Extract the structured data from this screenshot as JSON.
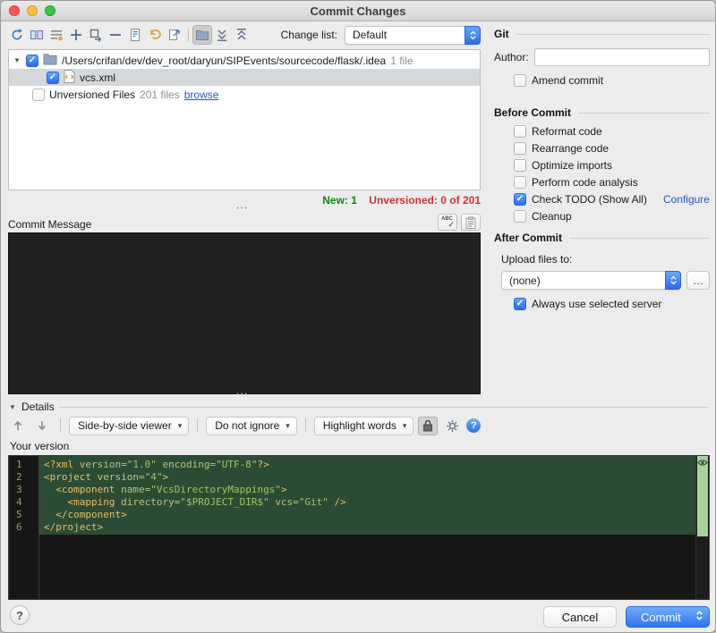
{
  "window": {
    "title": "Commit Changes"
  },
  "icons": {
    "disclosure_down": "▼",
    "dropdown_arrow": "▾",
    "splitter_dots": "•••",
    "check": "✓",
    "abc": "ABC",
    "help": "?"
  },
  "toolbar": {
    "change_list_label": "Change list:",
    "change_list_value": "Default"
  },
  "tree": {
    "rows": [
      {
        "path": "/Users/crifan/dev/dev_root/daryun/SIPEvents/sourcecode/flask/.idea",
        "meta": "1 file",
        "checked": true
      },
      {
        "file": "vcs.xml",
        "checked": true,
        "selected": true
      },
      {
        "label": "Unversioned Files",
        "meta": "201 files",
        "link": "browse",
        "checked": false
      }
    ]
  },
  "status": {
    "new": "New: 1",
    "unversioned": "Unversioned: 0 of 201"
  },
  "commit_message": {
    "label": "Commit Message",
    "value": ""
  },
  "git": {
    "title": "Git",
    "author_label": "Author:",
    "author_value": "",
    "amend_label": "Amend commit"
  },
  "before_commit": {
    "title": "Before Commit",
    "items": [
      {
        "label": "Reformat code",
        "checked": false
      },
      {
        "label": "Rearrange code",
        "checked": false
      },
      {
        "label": "Optimize imports",
        "checked": false
      },
      {
        "label": "Perform code analysis",
        "checked": false
      },
      {
        "label": "Check TODO (Show All)",
        "checked": true,
        "link": "Configure"
      },
      {
        "label": "Cleanup",
        "checked": false
      }
    ]
  },
  "after_commit": {
    "title": "After Commit",
    "upload_label": "Upload files to:",
    "upload_value": "(none)",
    "more": "…",
    "always_label": "Always use selected server",
    "always_checked": true
  },
  "details": {
    "title": "Details",
    "viewer": "Side-by-side viewer",
    "ignore": "Do not ignore",
    "highlight": "Highlight words",
    "version_label": "Your version"
  },
  "diff": {
    "lines": [
      {
        "num": "1",
        "parts": [
          [
            "<?xml ",
            "tag"
          ],
          [
            "version=",
            "attr"
          ],
          [
            "\"1.0\"",
            "val"
          ],
          [
            " ",
            "p"
          ],
          [
            "encoding=",
            "attr"
          ],
          [
            "\"UTF-8\"",
            "val"
          ],
          [
            "?>",
            "tag"
          ]
        ]
      },
      {
        "num": "2",
        "parts": [
          [
            "<project ",
            "tag"
          ],
          [
            "version=",
            "attr"
          ],
          [
            "\"4\"",
            "val"
          ],
          [
            ">",
            "tag"
          ]
        ]
      },
      {
        "num": "3",
        "parts": [
          [
            "  ",
            "p"
          ],
          [
            "<component ",
            "tag"
          ],
          [
            "name=",
            "attr"
          ],
          [
            "\"VcsDirectoryMappings\"",
            "val"
          ],
          [
            ">",
            "tag"
          ]
        ]
      },
      {
        "num": "4",
        "parts": [
          [
            "    ",
            "p"
          ],
          [
            "<mapping ",
            "tag"
          ],
          [
            "directory=",
            "attr"
          ],
          [
            "\"$PROJECT_DIR$\"",
            "val"
          ],
          [
            " ",
            "p"
          ],
          [
            "vcs=",
            "attr"
          ],
          [
            "\"Git\"",
            "val"
          ],
          [
            " />",
            "tag"
          ]
        ]
      },
      {
        "num": "5",
        "parts": [
          [
            "  ",
            "p"
          ],
          [
            "</component>",
            "tag"
          ]
        ]
      },
      {
        "num": "6",
        "parts": [
          [
            "</project>",
            "tag"
          ]
        ]
      }
    ]
  },
  "footer": {
    "help": "?",
    "cancel": "Cancel",
    "commit": "Commit"
  },
  "colors": {
    "accent_blue": "#2f72f0",
    "status_new_green": "#0a8a08",
    "status_unversioned_red": "#cc3333",
    "diff_added_bg": "#2c4b35",
    "code_tag": "#e8bf6a",
    "code_attr": "#b9c27d",
    "code_value": "#a5c261"
  }
}
